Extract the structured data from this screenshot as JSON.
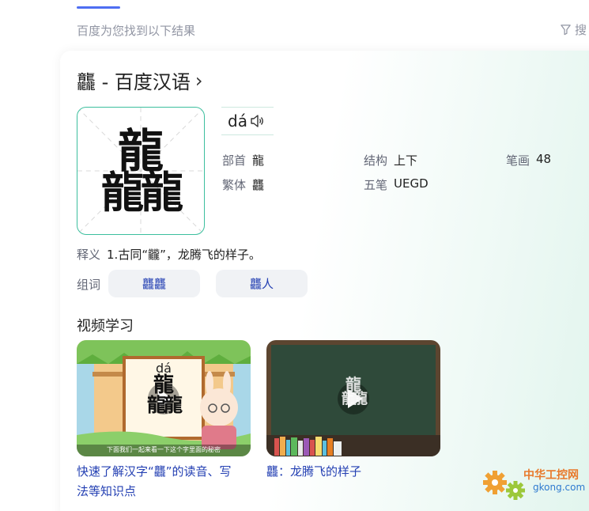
{
  "header": {
    "result_hint": "百度为您找到以下结果",
    "filter_label": "搜"
  },
  "card": {
    "title": "龘 - 百度汉语",
    "big_char_top": "龍",
    "big_char_bottom": "龍龍",
    "pinyin": "dá",
    "radical_key": "部首",
    "radical_val": "龍",
    "structure_key": "结构",
    "structure_val": "上下",
    "strokes_key": "笔画",
    "strokes_val": "48",
    "traditional_key": "繁体",
    "traditional_val": "龘",
    "wubi_key": "五笔",
    "wubi_val": "UEGD",
    "meaning_key": "释义",
    "meaning_val": "1.古同“龖”，龙腾飞的样子。",
    "words_key": "组词",
    "words": [
      "龘龘",
      "龘人"
    ]
  },
  "videos": {
    "section_title": "视频学习",
    "items": [
      {
        "title_line1": "快速了解汉字“龘”的读音、写",
        "title_line2": "法等知识点",
        "thumb_pinyin": "dá",
        "thumb_caption": "下面我们一起来看一下这个字里面的秘密"
      },
      {
        "title_line1": "龘：龙腾飞的样子",
        "title_line2": ""
      }
    ]
  },
  "watermark": {
    "name": "中华工控网",
    "domain": "gkong.com"
  },
  "colors": {
    "accent_blue": "#4e6ef2",
    "link_blue": "#2440b3",
    "teal_border": "#3cbf9e"
  }
}
